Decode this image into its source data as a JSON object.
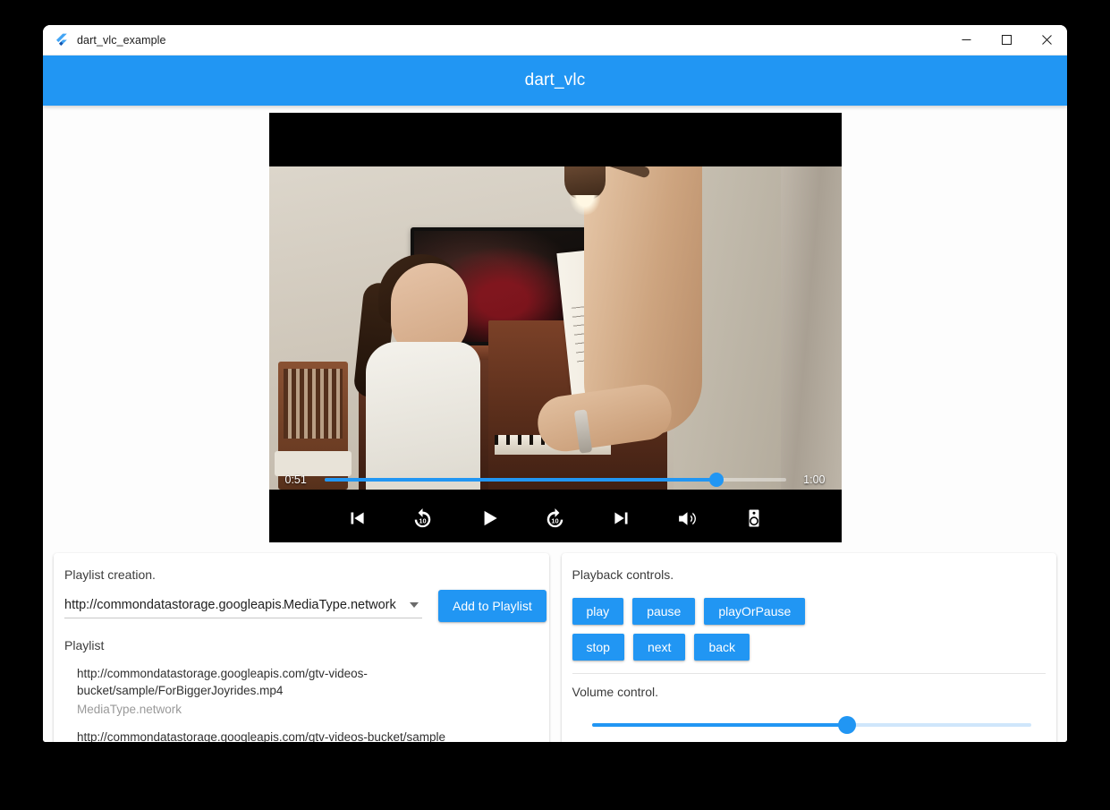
{
  "titlebar": {
    "app_title": "dart_vlc_example",
    "icon": "flutter-logo-icon",
    "minimize_label": "—",
    "maximize_label": "□",
    "close_label": "✕"
  },
  "appbar": {
    "title": "dart_vlc",
    "background": "#2196f3",
    "text_color": "#ffffff"
  },
  "player": {
    "current_time": "0:51",
    "total_time": "1:00",
    "progress_percent": 85,
    "accent": "#2196f3",
    "controls": [
      {
        "name": "skip-previous-icon",
        "label": "skip previous"
      },
      {
        "name": "replay-10-icon",
        "label": "replay 10"
      },
      {
        "name": "play-icon",
        "label": "play"
      },
      {
        "name": "forward-10-icon",
        "label": "forward 10"
      },
      {
        "name": "skip-next-icon",
        "label": "skip next"
      },
      {
        "name": "volume-up-icon",
        "label": "volume"
      },
      {
        "name": "speaker-device-icon",
        "label": "audio device"
      }
    ]
  },
  "playlist_panel": {
    "heading": "Playlist creation.",
    "url_value": "http://commondatastorage.googleapis.c",
    "media_type_value": "MediaType.network",
    "add_button": "Add to Playlist",
    "playlist_title": "Playlist",
    "items": [
      {
        "url": "http://commondatastorage.googleapis.com/gtv-videos-bucket/sample/ForBiggerJoyrides.mp4",
        "type": "MediaType.network"
      },
      {
        "url": "http://commondatastorage.googleapis.com/gtv-videos-bucket/sample",
        "type": ""
      }
    ]
  },
  "controls_panel": {
    "heading": "Playback controls.",
    "buttons_row1": [
      "play",
      "pause",
      "playOrPause"
    ],
    "buttons_row2": [
      "stop",
      "next",
      "back"
    ],
    "volume_heading": "Volume control.",
    "volume_percent": 58
  }
}
